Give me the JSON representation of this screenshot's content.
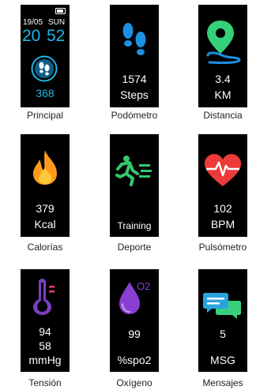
{
  "screens": [
    {
      "id": "principal",
      "caption": "Principal",
      "date": "19/05",
      "weekday": "SUN",
      "hour": "20",
      "minute": "52",
      "steps": "368",
      "icon": "footprints-icon",
      "accent": "#1fb6e8"
    },
    {
      "id": "podometro",
      "caption": "Podómetro",
      "value": "1574",
      "unit": "Steps",
      "icon": "footprints-icon",
      "accent": "#1c8fe0"
    },
    {
      "id": "distancia",
      "caption": "Distancia",
      "value": "3.4",
      "unit": "KM",
      "icon": "map-pin-icon",
      "accent": "#36d07a"
    },
    {
      "id": "calorias",
      "caption": "Calorías",
      "value": "379",
      "unit": "Kcal",
      "icon": "flame-icon",
      "accent": "#ff9a1a"
    },
    {
      "id": "deporte",
      "caption": "Deporte",
      "value": "Training",
      "icon": "running-person-icon",
      "accent": "#32c86e"
    },
    {
      "id": "pulsometro",
      "caption": "Pulsómetro",
      "value": "102",
      "unit": "BPM",
      "icon": "heart-pulse-icon",
      "accent": "#ee3a3a"
    },
    {
      "id": "tension",
      "caption": "Tensión",
      "value": "94",
      "value2": "58",
      "unit": "mmHg",
      "icon": "thermometer-icon",
      "accent": "#7b3ec4"
    },
    {
      "id": "oxigeno",
      "caption": "Oxígeno",
      "value": "99",
      "unit": "%spo2",
      "icon": "o2-drop-icon",
      "badge": "O2",
      "accent": "#8a3fd1"
    },
    {
      "id": "mensajes",
      "caption": "Mensajes",
      "value": "5",
      "unit": "MSG",
      "icon": "chat-bubbles-icon",
      "accent": "#2aa3dd"
    }
  ]
}
